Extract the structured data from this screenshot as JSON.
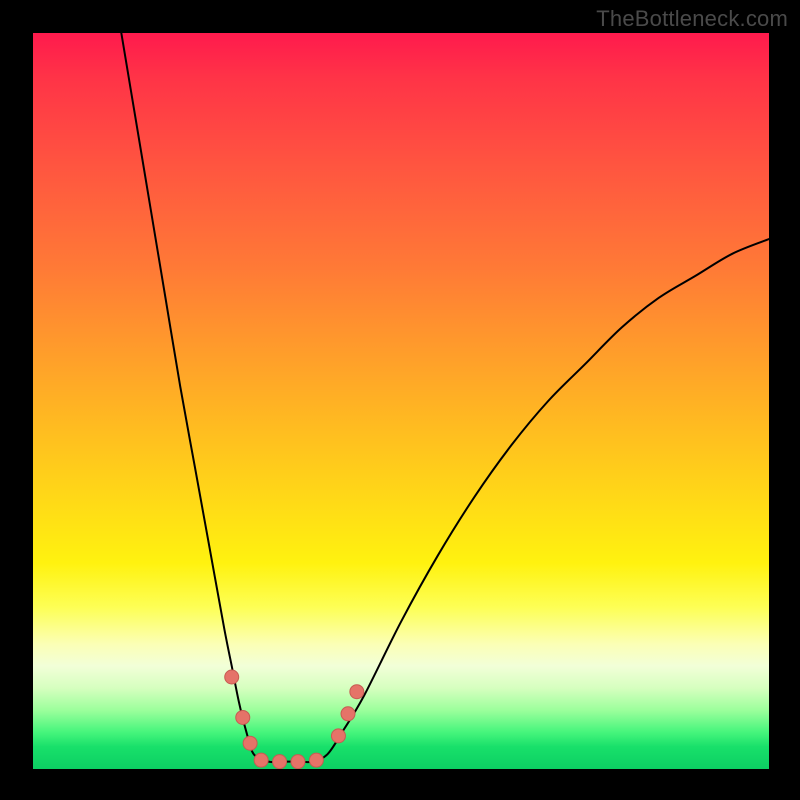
{
  "watermark": "TheBottleneck.com",
  "colors": {
    "frame": "#000000",
    "curve_stroke": "#000000",
    "marker_fill": "#e57368",
    "marker_stroke": "#c75b52",
    "gradient_stops": [
      "#ff1a4d",
      "#ff3347",
      "#ff5540",
      "#ff7a36",
      "#ffa528",
      "#ffcf1a",
      "#fff20f",
      "#fdff55",
      "#fbffb5",
      "#f2ffd8",
      "#d6ffbf",
      "#9cff9c",
      "#46f57c",
      "#18e06a",
      "#0ccf63"
    ]
  },
  "chart_data": {
    "type": "line",
    "title": "",
    "xlabel": "",
    "ylabel": "",
    "xlim": [
      0,
      100
    ],
    "ylim": [
      0,
      100
    ],
    "grid": false,
    "series": [
      {
        "name": "left-branch",
        "x": [
          12,
          14,
          16,
          18,
          20,
          22,
          24,
          26,
          27,
          28,
          29,
          30
        ],
        "y": [
          100,
          88,
          76,
          64,
          52,
          41,
          30,
          19,
          14,
          9,
          5,
          2
        ]
      },
      {
        "name": "valley-floor",
        "x": [
          30,
          32,
          34,
          36,
          38,
          40
        ],
        "y": [
          2,
          1,
          1,
          1,
          1,
          2
        ]
      },
      {
        "name": "right-branch",
        "x": [
          40,
          42,
          45,
          50,
          55,
          60,
          65,
          70,
          75,
          80,
          85,
          90,
          95,
          100
        ],
        "y": [
          2,
          5,
          10,
          20,
          29,
          37,
          44,
          50,
          55,
          60,
          64,
          67,
          70,
          72
        ]
      }
    ],
    "markers": [
      {
        "name": "left-upper",
        "x": 27.0,
        "y": 12.5
      },
      {
        "name": "left-mid",
        "x": 28.5,
        "y": 7.0
      },
      {
        "name": "left-lower",
        "x": 29.5,
        "y": 3.5
      },
      {
        "name": "floor-a",
        "x": 31.0,
        "y": 1.2
      },
      {
        "name": "floor-b",
        "x": 33.5,
        "y": 1.0
      },
      {
        "name": "floor-c",
        "x": 36.0,
        "y": 1.0
      },
      {
        "name": "floor-d",
        "x": 38.5,
        "y": 1.2
      },
      {
        "name": "right-lower",
        "x": 41.5,
        "y": 4.5
      },
      {
        "name": "right-mid",
        "x": 42.8,
        "y": 7.5
      },
      {
        "name": "right-upper",
        "x": 44.0,
        "y": 10.5
      }
    ]
  }
}
